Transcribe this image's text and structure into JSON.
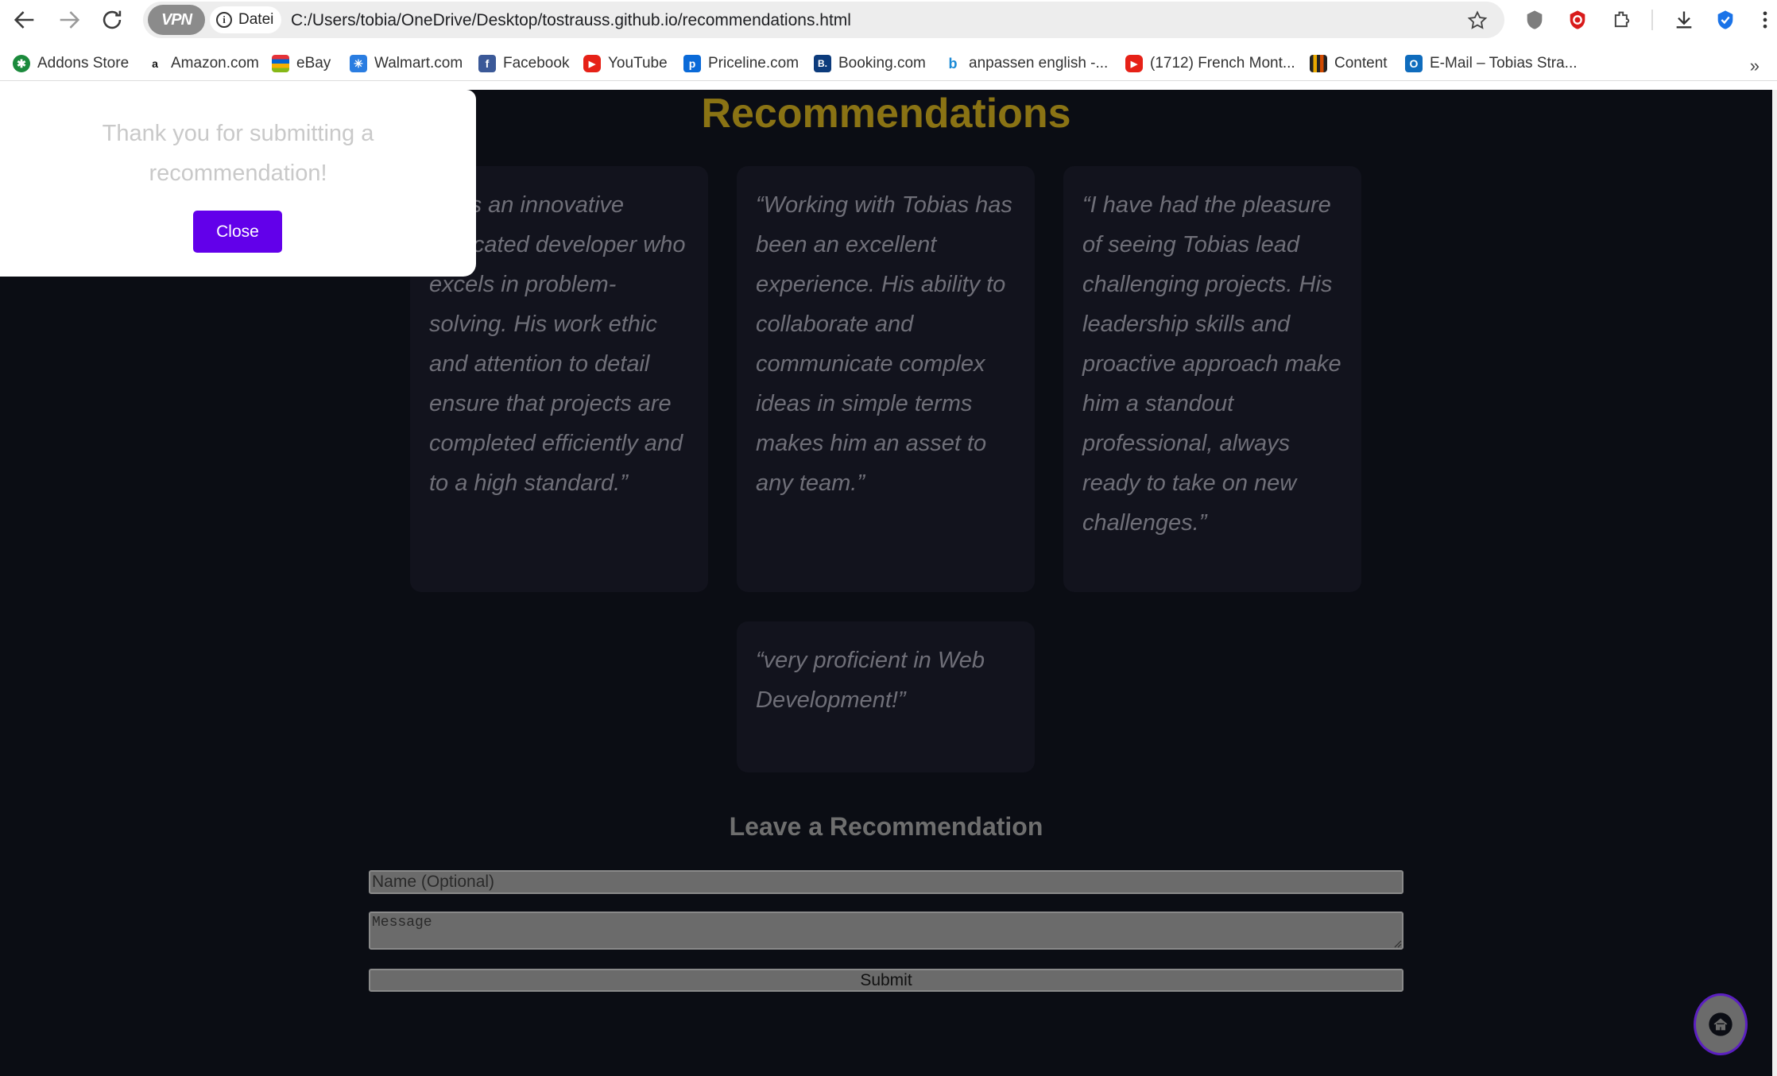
{
  "browser": {
    "vpn_label": "VPN",
    "site_info_label": "Datei",
    "url": "C:/Users/tobia/OneDrive/Desktop/tostrauss.github.io/recommendations.html"
  },
  "bookmarks": [
    {
      "label": "Addons Store",
      "icon": "addons-store-icon",
      "color": "#1b8a3c",
      "glyph": "✱"
    },
    {
      "label": "Amazon.com",
      "icon": "amazon-icon",
      "color": "#ffffff",
      "glyph": "a"
    },
    {
      "label": "eBay",
      "icon": "ebay-icon",
      "color": "#ffffff",
      "glyph": ""
    },
    {
      "label": "Walmart.com",
      "icon": "walmart-icon",
      "color": "#2a7de1",
      "glyph": "✳"
    },
    {
      "label": "Facebook",
      "icon": "facebook-icon",
      "color": "#3b5998",
      "glyph": "f"
    },
    {
      "label": "YouTube",
      "icon": "youtube-icon",
      "color": "#e62117",
      "glyph": "▶"
    },
    {
      "label": "Priceline.com",
      "icon": "priceline-icon",
      "color": "#0a6ad8",
      "glyph": "p"
    },
    {
      "label": "Booking.com",
      "icon": "booking-icon",
      "color": "#0c3b7c",
      "glyph": "B."
    },
    {
      "label": "anpassen english -...",
      "icon": "bing-icon",
      "color": "#ffffff",
      "glyph": "b"
    },
    {
      "label": "(1712) French Mont...",
      "icon": "youtube-icon",
      "color": "#e62117",
      "glyph": "▶"
    },
    {
      "label": "Content",
      "icon": "content-icon",
      "color": "#ffffff",
      "glyph": ""
    },
    {
      "label": "E-Mail – Tobias Stra...",
      "icon": "outlook-icon",
      "color": "#0f6cbd",
      "glyph": "O"
    }
  ],
  "page": {
    "title": "Recommendations",
    "recommendations": [
      "ias is an innovative dedicated developer who excels in problem-solving. His work ethic and attention to detail ensure that projects are completed efficiently and to a high standard.”",
      "“Working with Tobias has been an excellent experience. His ability to collaborate and communicate complex ideas in simple terms makes him an asset to any team.”",
      "“I have had the pleasure of seeing Tobias lead challenging projects. His leadership skills and proactive approach make him a standout professional, always ready to take on new challenges.”",
      "“very proficient in Web Development!”"
    ],
    "form": {
      "heading": "Leave a Recommendation",
      "name_placeholder": "Name (Optional)",
      "message_placeholder": "Message",
      "submit_label": "Submit"
    }
  },
  "modal": {
    "message": "Thank you for submitting a recommendation!",
    "close_label": "Close"
  },
  "colors": {
    "page_bg": "#0b0d14",
    "title": "#8a7314",
    "close_button": "#6200ea",
    "fab_border": "#5b1fc0"
  }
}
